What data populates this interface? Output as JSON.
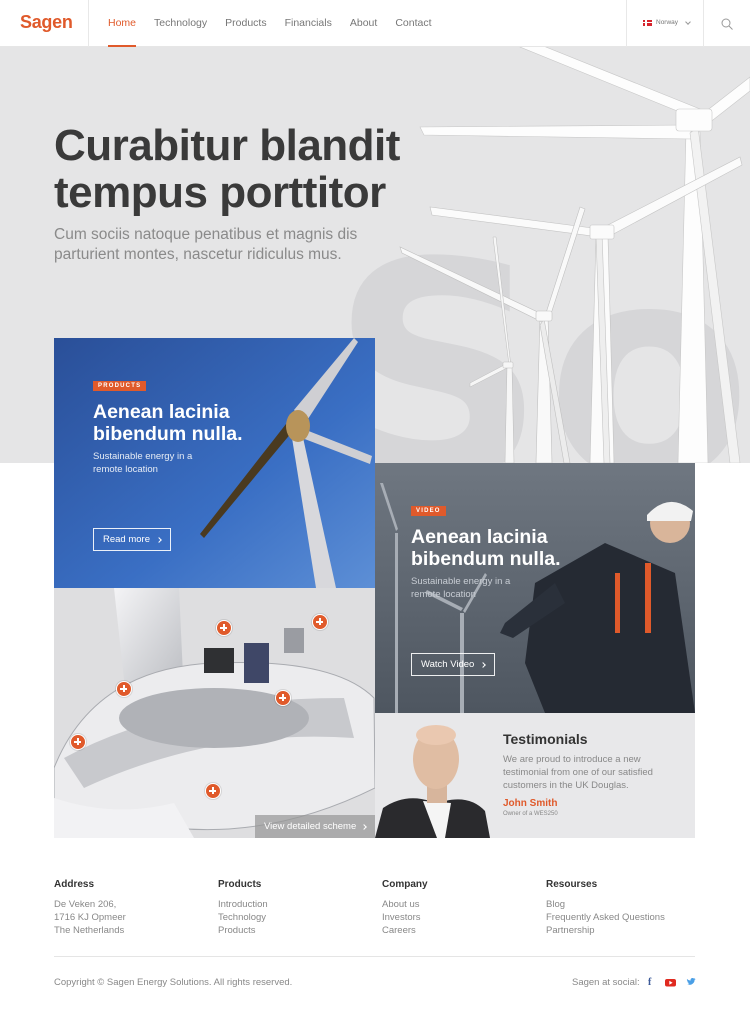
{
  "header": {
    "logo": "Sagen",
    "nav": [
      "Home",
      "Technology",
      "Products",
      "Financials",
      "About",
      "Contact"
    ],
    "active_nav": "Home",
    "language": "Norway"
  },
  "hero": {
    "title": "Curabitur blandit tempus porttitor",
    "subtitle": "Cum sociis natoque penatibus et magnis dis parturient montes, nascetur ridiculus mus."
  },
  "cards": {
    "products": {
      "tag": "PRODUCTS",
      "title": "Aenean lacinia bibendum nulla.",
      "subtitle": "Sustainable energy in a remote location",
      "button": "Read more"
    },
    "video": {
      "tag": "VIDEO",
      "title": "Aenean lacinia bibendum nulla.",
      "subtitle": "Sustainable energy in a remote location",
      "button": "Watch Video"
    },
    "scheme": {
      "button": "View detailed scheme"
    },
    "testimonials": {
      "title": "Testimonials",
      "text": "We are proud to introduce a new testimonial from one of our satisfied customers in the UK Douglas.",
      "name": "John Smith",
      "role": "Owner of a WES250"
    }
  },
  "footer": {
    "address": {
      "heading": "Address",
      "lines": [
        "De Veken 206,",
        "1716 KJ Opmeer",
        "The Netherlands"
      ]
    },
    "products": {
      "heading": "Products",
      "links": [
        "Introduction",
        "Technology",
        "Products"
      ]
    },
    "company": {
      "heading": "Company",
      "links": [
        "About us",
        "Investors",
        "Careers"
      ]
    },
    "resources": {
      "heading": "Resourses",
      "links": [
        "Blog",
        "Frequently Asked Questions",
        "Partnership"
      ]
    },
    "copyright": "Copyright © Sagen Energy Solutions. All rights reserved.",
    "social_label": "Sagen at social:",
    "social_icons": [
      "facebook-icon",
      "youtube-icon",
      "twitter-icon"
    ]
  },
  "colors": {
    "accent": "#e05a2b",
    "hero_bg": "#e5e5e6",
    "products_card_bg": "#2f5da8",
    "video_card_bg": "#5a6472"
  }
}
